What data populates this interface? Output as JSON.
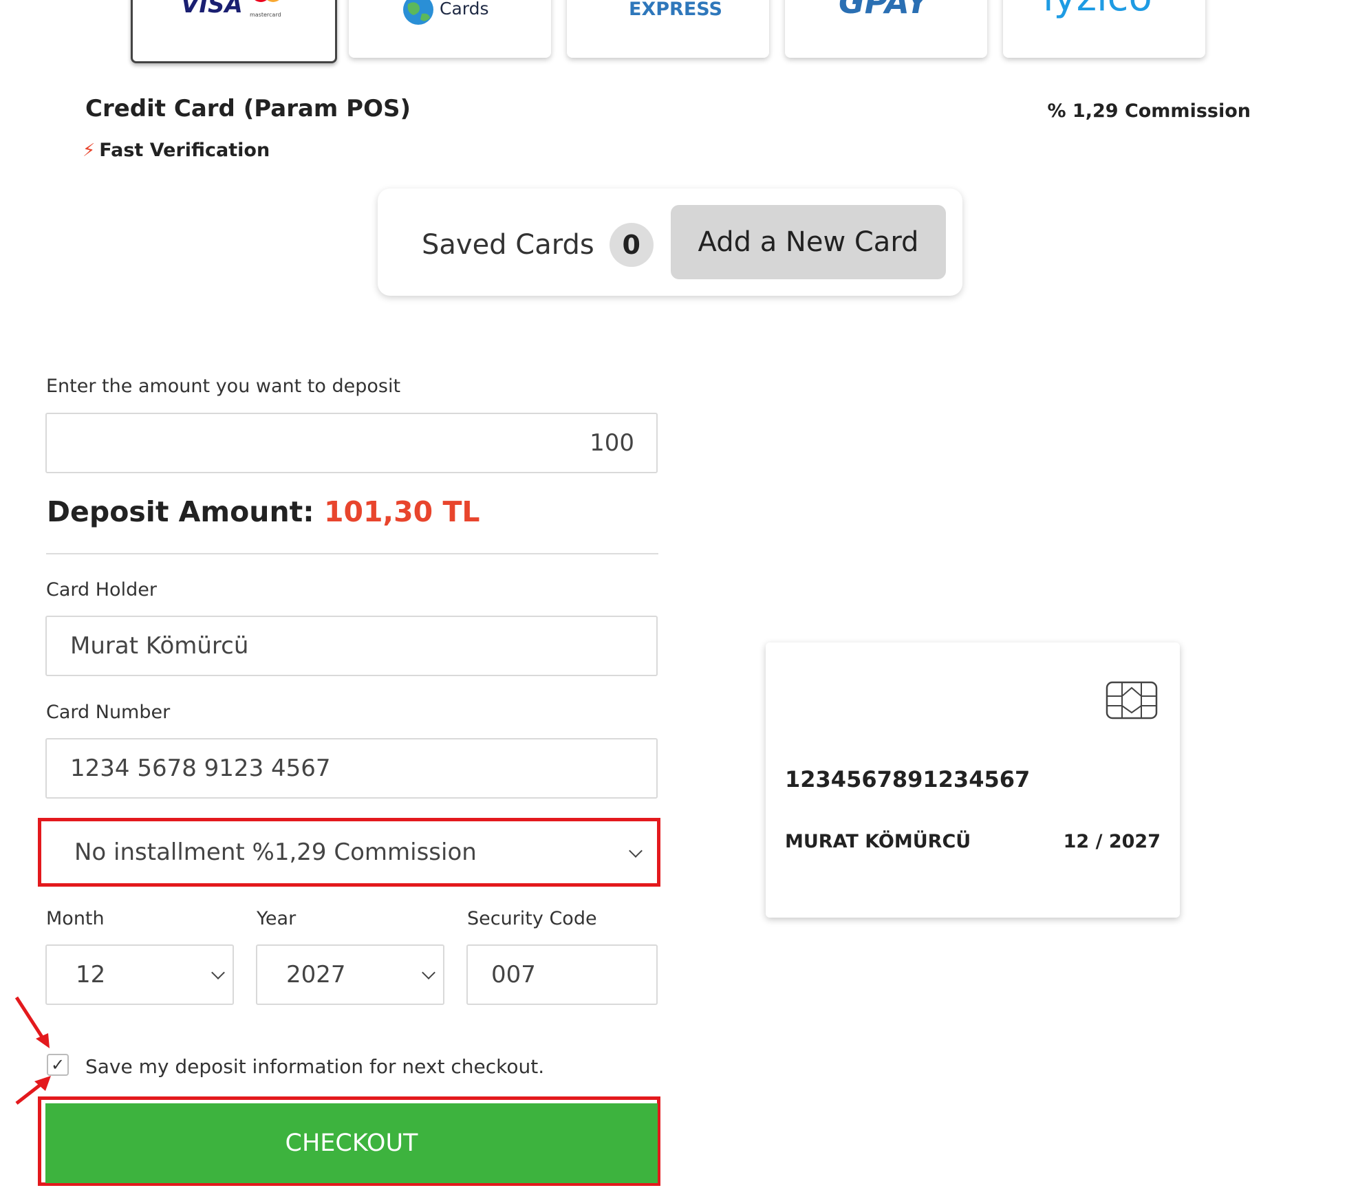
{
  "payment_methods": [
    {
      "logo_text": "VISA",
      "logo_sub": "mastercard",
      "selected": true
    },
    {
      "logo_text": "Cards",
      "selected": false
    },
    {
      "logo_text": "EXPRESS",
      "selected": false
    },
    {
      "logo_text": "GPAY",
      "selected": false
    },
    {
      "logo_text": "iyzico",
      "selected": false
    }
  ],
  "method": {
    "title": "Credit Card (Param POS)",
    "commission": "% 1,29 Commission",
    "fast_verification": "Fast Verification"
  },
  "tabs": {
    "saved_label": "Saved Cards",
    "saved_count": "0",
    "new_card_label": "Add a New Card"
  },
  "form": {
    "amount_label": "Enter the amount you want to deposit",
    "amount_value": "100",
    "deposit_label": "Deposit Amount:",
    "deposit_value": "101,30 TL",
    "holder_label": "Card Holder",
    "holder_value": "Murat Kömürcü",
    "number_label": "Card Number",
    "number_value": "1234 5678 9123 4567",
    "installment_value": "No installment %1,29 Commission",
    "month_label": "Month",
    "month_value": "12",
    "year_label": "Year",
    "year_value": "2027",
    "cvc_label": "Security Code",
    "cvc_value": "007",
    "save_label": "Save my deposit information for next checkout.",
    "save_checked": true,
    "checkout_label": "CHECKOUT"
  },
  "card_preview": {
    "number": "1234567891234567",
    "name": "MURAT KÖMÜRCÜ",
    "expiry": "12 / 2027"
  },
  "colors": {
    "accent_red": "#e8452d",
    "checkout_green": "#3db33e",
    "annotation_red": "#e3191d"
  }
}
